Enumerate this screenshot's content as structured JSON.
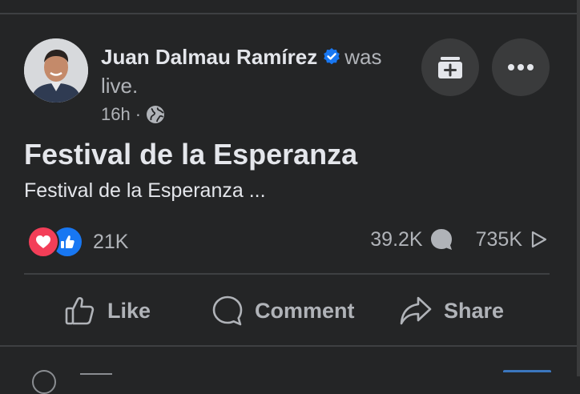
{
  "post": {
    "author": "Juan Dalmau Ramírez",
    "verified": true,
    "action_text": "was",
    "action_text_cont": "live.",
    "time": "16h",
    "separator": "·",
    "privacy_icon": "globe-icon",
    "title": "Festival de la Esperanza",
    "description": "Festival de la Esperanza ..."
  },
  "buttons": {
    "save_icon": "save-post-icon",
    "more_icon": "more-options-icon"
  },
  "reactions": {
    "types": [
      "love",
      "like"
    ],
    "count": "21K"
  },
  "stats": {
    "comments": "39.2K",
    "views": "735K"
  },
  "actions": {
    "like_label": "Like",
    "comment_label": "Comment",
    "share_label": "Share"
  },
  "colors": {
    "background": "#242526",
    "text_primary": "#e4e6eb",
    "text_secondary": "#b0b3b8",
    "button_bg": "#3a3b3c",
    "verified_blue": "#1877f2",
    "love_red": "#f33e58"
  }
}
